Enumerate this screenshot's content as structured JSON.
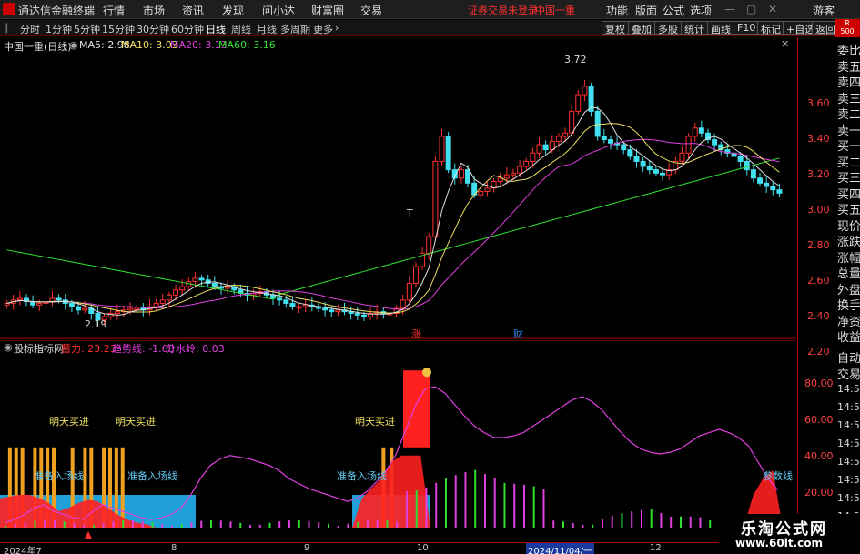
{
  "titlebar": {
    "app_title": "通达信金融终端",
    "menus": [
      "行情",
      "市场",
      "资讯",
      "发现",
      "问小达",
      "财富圈",
      "交易"
    ],
    "login_status": "证券交易未登录",
    "stock_name": "中国一重",
    "right_menus": [
      "功能",
      "版面",
      "公式",
      "选项"
    ],
    "guest": "游客"
  },
  "toolbar": {
    "periods": [
      "分时",
      "1分钟",
      "5分钟",
      "15分钟",
      "30分钟",
      "60分钟",
      "日线",
      "周线",
      "月线",
      "多周期",
      "更多"
    ],
    "active_period": "日线",
    "right_buttons": [
      "复权",
      "叠加",
      "多股",
      "统计",
      "画线",
      "F10",
      "标记",
      "+自选",
      "返回"
    ]
  },
  "main_chart": {
    "header_title": "中国一重(日线)",
    "ma_labels": [
      {
        "text": "MA5: 2.98",
        "color": "#e0e0e0"
      },
      {
        "text": "MA10: 3.03",
        "color": "#f0e060"
      },
      {
        "text": "MA20: 3.13",
        "color": "#e040e0"
      },
      {
        "text": "MA60: 3.16",
        "color": "#30e030"
      }
    ],
    "high_marker": "3.72",
    "low_marker": "2.19",
    "t_marker": "T",
    "flags": [
      {
        "text": "涨",
        "color": "#ff3030"
      },
      {
        "text": "财",
        "color": "#3090ff"
      }
    ],
    "y_ticks": [
      "3.60",
      "3.40",
      "3.20",
      "3.00",
      "2.80",
      "2.60",
      "2.40",
      "2.20"
    ]
  },
  "sub_chart": {
    "title": "股标指标网",
    "values": [
      {
        "text": "蓄力: 23.23",
        "color": "#ff3030"
      },
      {
        "text": "趋势线: -1.68",
        "color": "#e040e0"
      },
      {
        "text": "分水岭: 0.03",
        "color": "#e040e0"
      }
    ],
    "annotations": [
      "明天买进",
      "明天买进",
      "明天买进"
    ],
    "zone_labels": [
      "准备入场线",
      "准备入场线",
      "准备入场线",
      "参数线"
    ],
    "y_ticks": [
      "80.00",
      "60.00",
      "40.00",
      "20.00"
    ]
  },
  "right_panel": {
    "r_badge": "R\n500",
    "items": [
      "委比",
      "卖五",
      "卖四",
      "卖三",
      "卖二",
      "卖一",
      "买一",
      "买二",
      "买三",
      "买四",
      "买五",
      "现价",
      "涨跌",
      "涨幅",
      "总量",
      "外盘",
      "换手",
      "净资",
      "收益"
    ],
    "items2": [
      "自动",
      "交易"
    ],
    "times": [
      "14:56",
      "14:56",
      "14:56",
      "14:56",
      "14:56",
      "14:56",
      "14:56",
      "14:56"
    ]
  },
  "date_axis": [
    "2024年7",
    "8",
    "9",
    "10",
    "2024/11/04/一",
    "12"
  ],
  "watermark": {
    "line1": "乐淘公式网",
    "line2": "www.60lt.com"
  },
  "chart_data": [
    {
      "type": "candlestick",
      "title": "中国一重(日线)",
      "ylim": [
        2.15,
        3.85
      ],
      "x_range": [
        "2024-07",
        "2024-12"
      ],
      "close": [
        2.3,
        2.32,
        2.33,
        2.31,
        2.29,
        2.3,
        2.31,
        2.33,
        2.32,
        2.3,
        2.28,
        2.26,
        2.27,
        2.24,
        2.2,
        2.22,
        2.24,
        2.25,
        2.26,
        2.27,
        2.27,
        2.26,
        2.28,
        2.3,
        2.32,
        2.35,
        2.38,
        2.4,
        2.43,
        2.45,
        2.44,
        2.42,
        2.4,
        2.39,
        2.4,
        2.38,
        2.36,
        2.35,
        2.36,
        2.37,
        2.35,
        2.33,
        2.32,
        2.3,
        2.28,
        2.28,
        2.29,
        2.28,
        2.27,
        2.26,
        2.25,
        2.26,
        2.25,
        2.24,
        2.23,
        2.22,
        2.24,
        2.25,
        2.24,
        2.24,
        2.27,
        2.32,
        2.42,
        2.52,
        2.6,
        2.7,
        3.15,
        3.3,
        3.1,
        3.05,
        3.1,
        3.02,
        2.95,
        2.97,
        2.99,
        3.03,
        3.05,
        3.07,
        3.08,
        3.12,
        3.15,
        3.2,
        3.25,
        3.22,
        3.27,
        3.3,
        3.32,
        3.45,
        3.55,
        3.6,
        3.45,
        3.3,
        3.28,
        3.26,
        3.25,
        3.22,
        3.18,
        3.15,
        3.12,
        3.1,
        3.08,
        3.07,
        3.1,
        3.15,
        3.2,
        3.3,
        3.35,
        3.32,
        3.28,
        3.25,
        3.22,
        3.2,
        3.18,
        3.15,
        3.1,
        3.05,
        3.02,
        3.0,
        2.98,
        2.96
      ],
      "ma60_range": [
        2.35,
        3.17
      ]
    },
    {
      "type": "line",
      "title": "股标指标网",
      "ylim": [
        0,
        100
      ],
      "series": [
        {
          "name": "趋势线",
          "color": "#e040e0",
          "values": [
            3,
            5,
            8,
            12,
            14,
            10,
            8,
            6,
            5,
            10,
            14,
            12,
            10,
            8,
            6,
            5,
            6,
            8,
            12,
            20,
            30,
            38,
            42,
            44,
            43,
            42,
            40,
            38,
            35,
            30,
            27,
            24,
            22,
            20,
            18,
            16,
            18,
            22,
            28,
            35,
            45,
            60,
            75,
            85,
            86,
            82,
            75,
            68,
            62,
            58,
            55,
            55,
            56,
            58,
            62,
            66,
            70,
            74,
            78,
            80,
            77,
            72,
            65,
            58,
            52,
            48,
            46,
            45,
            46,
            48,
            52,
            56,
            58,
            60,
            58,
            55,
            50,
            40,
            30,
            23
          ]
        },
        {
          "name": "蓄力",
          "color": "#ff3030",
          "values": [
            18,
            19,
            20,
            20,
            18,
            15,
            10,
            12,
            15,
            17,
            16,
            12,
            8,
            5,
            3,
            2,
            0,
            0,
            0,
            0,
            0,
            0,
            0,
            0,
            0,
            0,
            0,
            0,
            0,
            0,
            0,
            0,
            0,
            0,
            0,
            0,
            0,
            18,
            24,
            30,
            40,
            44,
            44,
            44,
            0,
            0,
            0,
            0,
            0,
            0,
            0,
            0,
            0,
            0,
            0,
            0,
            0,
            0,
            0,
            0,
            0,
            0,
            0,
            0,
            0,
            0,
            0,
            0,
            0,
            0,
            0,
            0,
            0,
            0,
            0,
            0,
            0,
            20,
            30,
            35
          ]
        }
      ]
    }
  ]
}
